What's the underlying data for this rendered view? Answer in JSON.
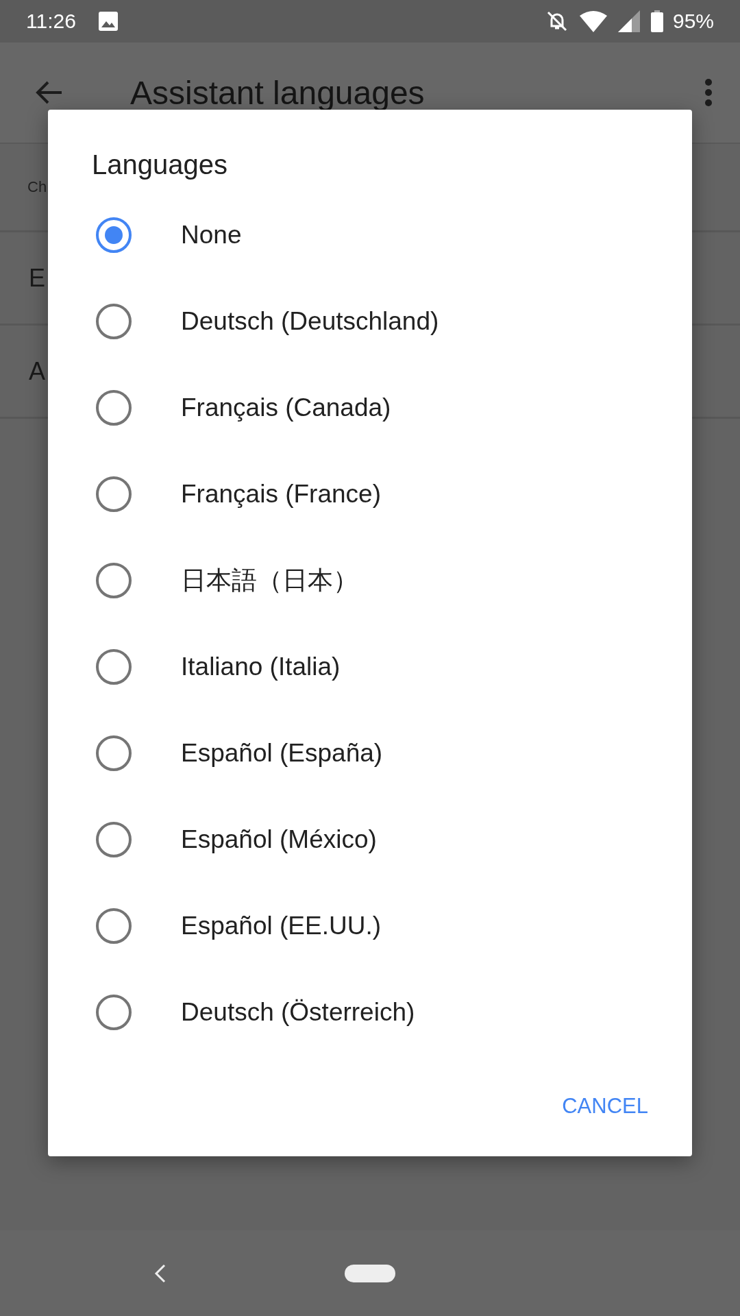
{
  "status_bar": {
    "time": "11:26",
    "battery": "95%"
  },
  "app_bar": {
    "title": "Assistant languages"
  },
  "background_rows": [
    {
      "text": "Ch",
      "kind": "caption"
    },
    {
      "text": "E",
      "kind": "item"
    },
    {
      "text": "A",
      "kind": "item"
    }
  ],
  "dialog": {
    "title": "Languages",
    "options": [
      {
        "label": "None",
        "selected": true
      },
      {
        "label": "Deutsch (Deutschland)",
        "selected": false
      },
      {
        "label": "Français (Canada)",
        "selected": false
      },
      {
        "label": "Français (France)",
        "selected": false
      },
      {
        "label": "日本語（日本）",
        "selected": false
      },
      {
        "label": "Italiano (Italia)",
        "selected": false
      },
      {
        "label": "Español (España)",
        "selected": false
      },
      {
        "label": "Español (México)",
        "selected": false
      },
      {
        "label": "Español (EE.UU.)",
        "selected": false
      },
      {
        "label": "Deutsch (Österreich)",
        "selected": false
      }
    ],
    "buttons": [
      "CANCEL"
    ]
  }
}
